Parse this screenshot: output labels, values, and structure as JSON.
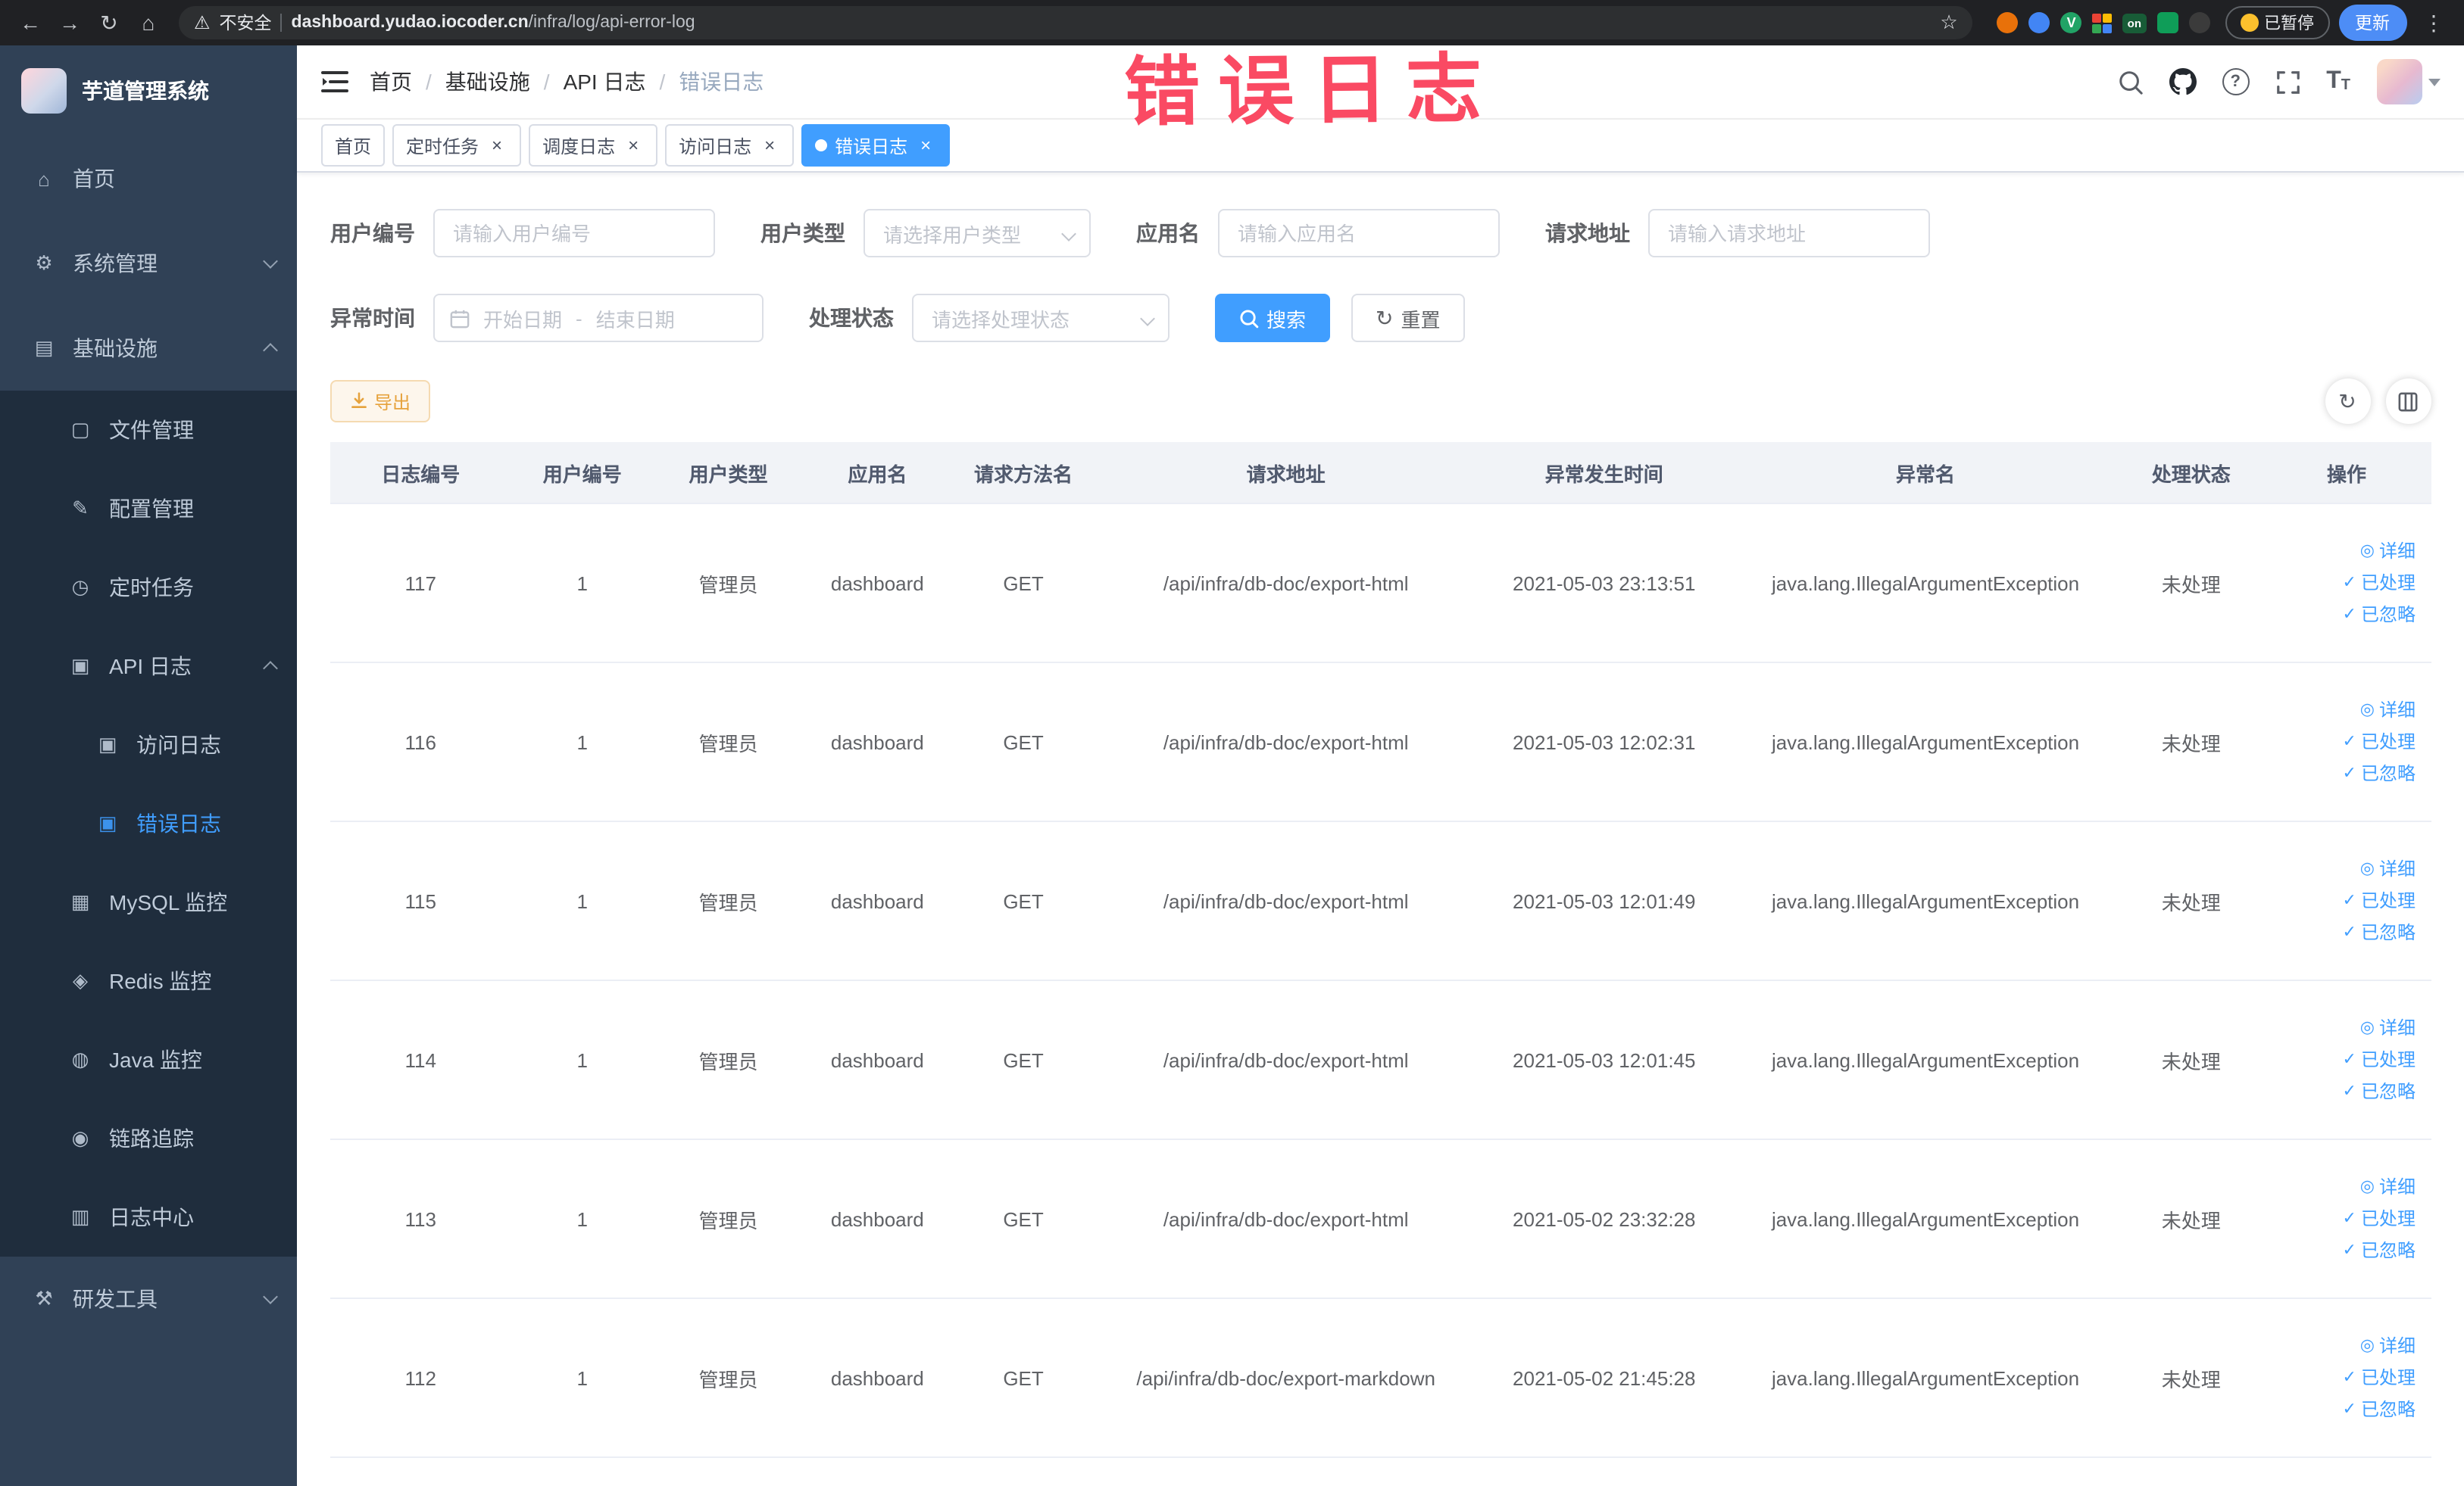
{
  "browser": {
    "security_label": "不安全",
    "url_domain": "dashboard.yudao.iocoder.cn",
    "url_path": "/infra/log/api-error-log",
    "paused_badge": "已暂停",
    "update_label": "更新",
    "extension_on_badge": "on",
    "extension_v_label": "V"
  },
  "icons": {
    "back": "←",
    "forward": "→",
    "reload": "↻",
    "home": "⌂",
    "warning": "⚠",
    "star": "☆",
    "dots": "⋮",
    "question": "?",
    "font_t": "T",
    "refresh": "↻"
  },
  "ui": {
    "close_glyph": "×"
  },
  "annotation": {
    "text": "错误日志",
    "color": "#fa4a63"
  },
  "sidebar": {
    "title": "芋道管理系统",
    "items": [
      {
        "id": "home",
        "label": "首页",
        "icon": "home-icon",
        "glyph": "⌂",
        "level": 0
      },
      {
        "id": "system-management",
        "label": "系统管理",
        "icon": "gear-icon",
        "glyph": "⚙",
        "level": 0,
        "chevron": "down"
      },
      {
        "id": "infrastructure",
        "label": "基础设施",
        "icon": "infra-icon",
        "glyph": "▤",
        "level": 0,
        "chevron": "up"
      },
      {
        "id": "file-management",
        "label": "文件管理",
        "icon": "folder-icon",
        "glyph": "▢",
        "level": 1
      },
      {
        "id": "config-management",
        "label": "配置管理",
        "icon": "edit-icon",
        "glyph": "✎",
        "level": 1
      },
      {
        "id": "scheduled-jobs",
        "label": "定时任务",
        "icon": "clock-icon",
        "glyph": "◷",
        "level": 1
      },
      {
        "id": "api-log",
        "label": "API 日志",
        "icon": "document-icon",
        "glyph": "▣",
        "level": 1,
        "chevron": "up"
      },
      {
        "id": "access-log",
        "label": "访问日志",
        "icon": "document-icon",
        "glyph": "▣",
        "level": 2
      },
      {
        "id": "error-log",
        "label": "错误日志",
        "icon": "document-icon",
        "glyph": "▣",
        "level": 2,
        "active": true
      },
      {
        "id": "mysql-monitor",
        "label": "MySQL 监控",
        "icon": "database-icon",
        "glyph": "▦",
        "level": 1
      },
      {
        "id": "redis-monitor",
        "label": "Redis 监控",
        "icon": "database-icon",
        "glyph": "◈",
        "level": 1
      },
      {
        "id": "java-monitor",
        "label": "Java 监控",
        "icon": "monitor-icon",
        "glyph": "◍",
        "level": 1
      },
      {
        "id": "tracing",
        "label": "链路追踪",
        "icon": "eye-icon",
        "glyph": "◉",
        "level": 1
      },
      {
        "id": "log-center",
        "label": "日志中心",
        "icon": "log-icon",
        "glyph": "▥",
        "level": 1
      },
      {
        "id": "dev-tools",
        "label": "研发工具",
        "icon": "tools-icon",
        "glyph": "⚒",
        "level": 0,
        "chevron": "down"
      }
    ]
  },
  "header": {
    "breadcrumb": [
      "首页",
      "基础设施",
      "API 日志",
      "错误日志"
    ],
    "separator": "/"
  },
  "tags": [
    {
      "id": "home",
      "label": "首页",
      "closable": false,
      "active": false
    },
    {
      "id": "job",
      "label": "定时任务",
      "closable": true,
      "active": false
    },
    {
      "id": "job-log",
      "label": "调度日志",
      "closable": true,
      "active": false
    },
    {
      "id": "api-access-log",
      "label": "访问日志",
      "closable": true,
      "active": false
    },
    {
      "id": "api-error-log",
      "label": "错误日志",
      "closable": true,
      "active": true
    }
  ],
  "filters": {
    "user_id_label": "用户编号",
    "user_id_placeholder": "请输入用户编号",
    "user_type_label": "用户类型",
    "user_type_placeholder": "请选择用户类型",
    "app_name_label": "应用名",
    "app_name_placeholder": "请输入应用名",
    "request_url_label": "请求地址",
    "request_url_placeholder": "请输入请求地址",
    "exception_time_label": "异常时间",
    "date_start_placeholder": "开始日期",
    "date_separator": "-",
    "date_end_placeholder": "结束日期",
    "process_status_label": "处理状态",
    "process_status_placeholder": "请选择处理状态",
    "search_label": "搜索",
    "reset_label": "重置"
  },
  "toolbar": {
    "export_label": "导出"
  },
  "table": {
    "columns": [
      "日志编号",
      "用户编号",
      "用户类型",
      "应用名",
      "请求方法名",
      "请求地址",
      "异常发生时间",
      "异常名",
      "处理状态",
      "操作"
    ],
    "row_actions": [
      {
        "name": "detail-link",
        "icon": "eye-icon",
        "glyph": "◎",
        "label": "详细"
      },
      {
        "name": "processed-link",
        "icon": "check-icon",
        "glyph": "✓",
        "label": "已处理"
      },
      {
        "name": "ignore-link",
        "icon": "check-icon",
        "glyph": "✓",
        "label": "已忽略"
      }
    ],
    "rows": [
      {
        "log_id": "117",
        "user_id": "1",
        "user_type": "管理员",
        "app_name": "dashboard",
        "method": "GET",
        "url": "/api/infra/db-doc/export-html",
        "time": "2021-05-03 23:13:51",
        "exception": "java.lang.IllegalArgumentException",
        "status": "未处理"
      },
      {
        "log_id": "116",
        "user_id": "1",
        "user_type": "管理员",
        "app_name": "dashboard",
        "method": "GET",
        "url": "/api/infra/db-doc/export-html",
        "time": "2021-05-03 12:02:31",
        "exception": "java.lang.IllegalArgumentException",
        "status": "未处理"
      },
      {
        "log_id": "115",
        "user_id": "1",
        "user_type": "管理员",
        "app_name": "dashboard",
        "method": "GET",
        "url": "/api/infra/db-doc/export-html",
        "time": "2021-05-03 12:01:49",
        "exception": "java.lang.IllegalArgumentException",
        "status": "未处理"
      },
      {
        "log_id": "114",
        "user_id": "1",
        "user_type": "管理员",
        "app_name": "dashboard",
        "method": "GET",
        "url": "/api/infra/db-doc/export-html",
        "time": "2021-05-03 12:01:45",
        "exception": "java.lang.IllegalArgumentException",
        "status": "未处理"
      },
      {
        "log_id": "113",
        "user_id": "1",
        "user_type": "管理员",
        "app_name": "dashboard",
        "method": "GET",
        "url": "/api/infra/db-doc/export-html",
        "time": "2021-05-02 23:32:28",
        "exception": "java.lang.IllegalArgumentException",
        "status": "未处理"
      },
      {
        "log_id": "112",
        "user_id": "1",
        "user_type": "管理员",
        "app_name": "dashboard",
        "method": "GET",
        "url": "/api/infra/db-doc/export-markdown",
        "time": "2021-05-02 21:45:28",
        "exception": "java.lang.IllegalArgumentException",
        "status": "未处理"
      }
    ]
  },
  "colors": {
    "primary": "#409eff",
    "warning": "#e6a23c",
    "sidebar_bg": "#304156",
    "submenu_bg": "#1f2d3d",
    "annotation": "#fa4a63"
  }
}
